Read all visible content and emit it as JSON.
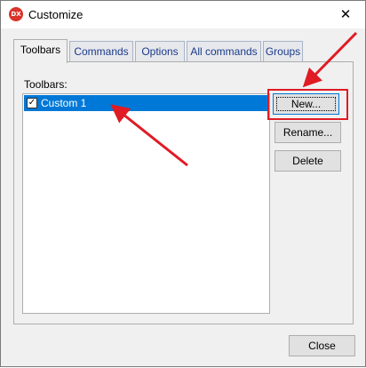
{
  "window": {
    "title": "Customize",
    "app_icon_text": "DX",
    "close_glyph": "✕"
  },
  "tabs": [
    {
      "label": "Toolbars",
      "active": true
    },
    {
      "label": "Commands",
      "active": false
    },
    {
      "label": "Options",
      "active": false
    },
    {
      "label": "All commands",
      "active": false
    },
    {
      "label": "Groups",
      "active": false
    }
  ],
  "toolbars_panel": {
    "list_label": "Toolbars:",
    "items": [
      {
        "label": "Custom 1",
        "checked": true,
        "selected": true
      }
    ],
    "check_glyph": "✓"
  },
  "buttons": {
    "new": "New...",
    "rename": "Rename...",
    "delete": "Delete",
    "close": "Close"
  },
  "colors": {
    "selection": "#0078d7",
    "annotation_red": "#e01b24",
    "app_icon": "#d9342b"
  }
}
